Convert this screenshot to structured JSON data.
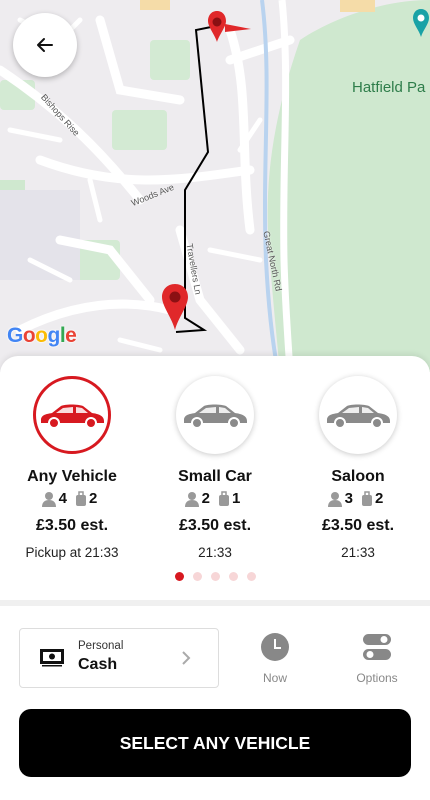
{
  "map": {
    "attribution": "Google",
    "park_label": "Hatfield Pa",
    "streets": {
      "bishops_rise": "Bishops Rise",
      "woods_ave": "Woods Ave",
      "travellers_ln": "Travellers Ln",
      "great_north_rd": "Great North Rd"
    }
  },
  "vehicles": [
    {
      "name": "Any Vehicle",
      "passengers": "4",
      "luggage": "2",
      "price": "£3.50 est.",
      "time": "Pickup at 21:33",
      "selected": true
    },
    {
      "name": "Small Car",
      "passengers": "2",
      "luggage": "1",
      "price": "£3.50 est.",
      "time": "21:33",
      "selected": false
    },
    {
      "name": "Saloon",
      "passengers": "3",
      "luggage": "2",
      "price": "£3.50 est.",
      "time": "21:33",
      "selected": false
    }
  ],
  "pager": {
    "total": 5,
    "active": 1
  },
  "payment": {
    "subtitle": "Personal",
    "method": "Cash"
  },
  "time_button": {
    "label": "Now"
  },
  "options_button": {
    "label": "Options"
  },
  "cta": {
    "label": "SELECT ANY VEHICLE"
  },
  "colors": {
    "brand": "#d71920",
    "cta_bg": "#000000",
    "inactive_car": "#8a8a8a"
  }
}
